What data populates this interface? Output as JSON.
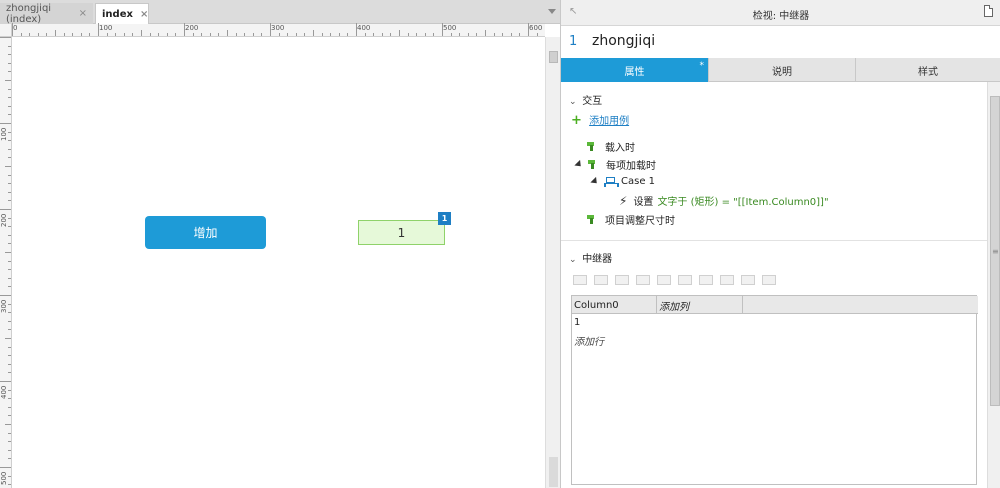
{
  "editor": {
    "tabs": [
      {
        "label": "zhongjiqi (index)",
        "close": "×"
      },
      {
        "label": "index",
        "close": "×"
      }
    ],
    "ruler_h": [
      "0",
      "100",
      "200",
      "300",
      "400",
      "500",
      "600"
    ],
    "ruler_v": [
      "100",
      "200",
      "300",
      "400",
      "500"
    ],
    "canvas": {
      "add_button_label": "增加",
      "repeater_cell_value": "1",
      "repeater_badge": "1"
    }
  },
  "inspector": {
    "header_title": "检视: 中继器",
    "back_icon": "↖",
    "widget_number": "1",
    "widget_name": "zhongjiqi",
    "tabs": [
      {
        "label": "属性",
        "star": "*"
      },
      {
        "label": "说明"
      },
      {
        "label": "样式"
      }
    ],
    "interaction": {
      "section_title": "交互",
      "add_case": "添加用例",
      "events": [
        {
          "label": "载入时"
        },
        {
          "label": "每项加载时"
        },
        {
          "label": "项目调整尺寸时"
        }
      ],
      "case_label": "Case 1",
      "action_prefix": "设置",
      "action_text": "文字于 (矩形) = \"[[Item.Column0]]\""
    },
    "repeater": {
      "section_title": "中继器",
      "columns": [
        "Column0",
        "添加列"
      ],
      "rows": [
        "1"
      ],
      "add_row": "添加行"
    }
  }
}
